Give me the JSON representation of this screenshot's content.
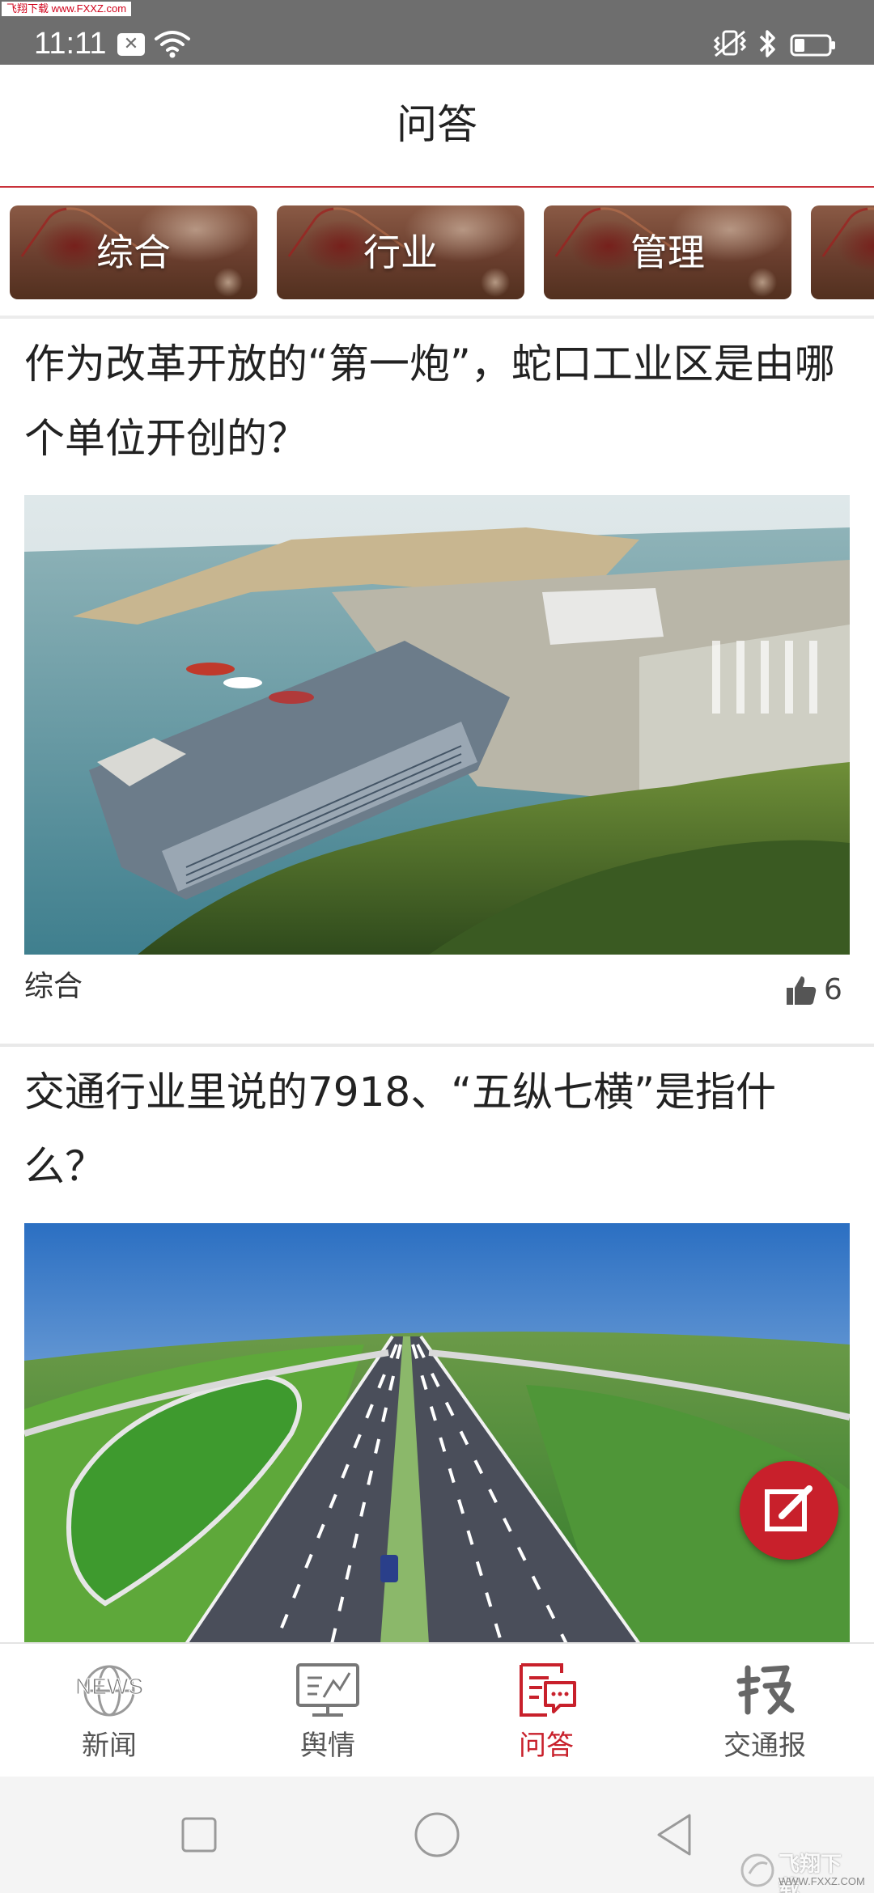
{
  "status_bar": {
    "watermark": "飞翔下载 www.FXXZ.com",
    "time": "11:11",
    "notification_icon": "close-box-icon",
    "icons": [
      "wifi-icon",
      "vibrate-icon",
      "bluetooth-icon",
      "battery-icon"
    ]
  },
  "header": {
    "title": "问答"
  },
  "categories": [
    {
      "label": "综合"
    },
    {
      "label": "行业"
    },
    {
      "label": "管理"
    },
    {
      "label": ""
    }
  ],
  "feed": {
    "items": [
      {
        "title": "作为改革开放的“第一炮”，蛇口工业区是由哪个单位开创的？",
        "image": "photo-aerial-industrial-port",
        "tag": "综合",
        "likes": "6"
      },
      {
        "title": "交通行业里说的7918、“五纵七横”是指什么？",
        "image": "photo-aerial-highway-interchange"
      }
    ]
  },
  "fab": {
    "icon": "compose-icon"
  },
  "bottom_nav": {
    "active": "问答",
    "items": [
      {
        "label": "新闻",
        "icon": "news-globe-icon"
      },
      {
        "label": "舆情",
        "icon": "monitor-chart-icon"
      },
      {
        "label": "问答",
        "icon": "qa-chat-icon"
      },
      {
        "label": "交通报",
        "icon": "newspaper-calligraphy-icon"
      }
    ]
  },
  "system_nav": {
    "buttons": [
      "recent-apps-square-icon",
      "home-circle-icon",
      "back-triangle-icon"
    ]
  },
  "bottom_watermark": {
    "text": "飞翔下载",
    "url": "WWW.FXXZ.COM"
  },
  "colors": {
    "accent": "#c8202b",
    "status_bar": "#6e6e6e",
    "system_nav": "#f4f4f4",
    "divider": "#e9e9e9"
  }
}
